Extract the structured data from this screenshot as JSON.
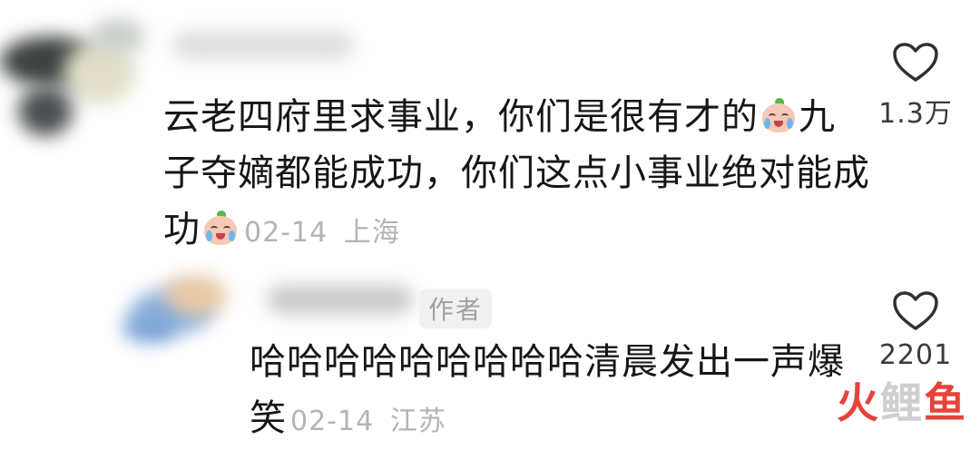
{
  "comments": [
    {
      "text_line1": "云老四府里求事业，你们是很有才的",
      "text_line1_tail": "九",
      "text_line2": "子夺嫡都能成功，你们这点小事业绝对能成",
      "text_line3": "功",
      "date": "02-14",
      "location": "上海",
      "like_count": "1.3万"
    },
    {
      "author_badge": "作者",
      "text_line1": "哈哈哈哈哈哈哈哈哈清晨发出一声爆",
      "text_line2": "笑",
      "date": "02-14",
      "location": "江苏",
      "like_count": "2201"
    }
  ],
  "icons": {
    "like": "heart-outline-icon",
    "emoji": "crying-laughing-emoji"
  },
  "watermark": {
    "part1": "火",
    "part2": "鲤",
    "part3": "鱼"
  },
  "colors": {
    "text": "#161616",
    "meta": "#b4b4b4",
    "watermark_red": "#e9413a"
  }
}
